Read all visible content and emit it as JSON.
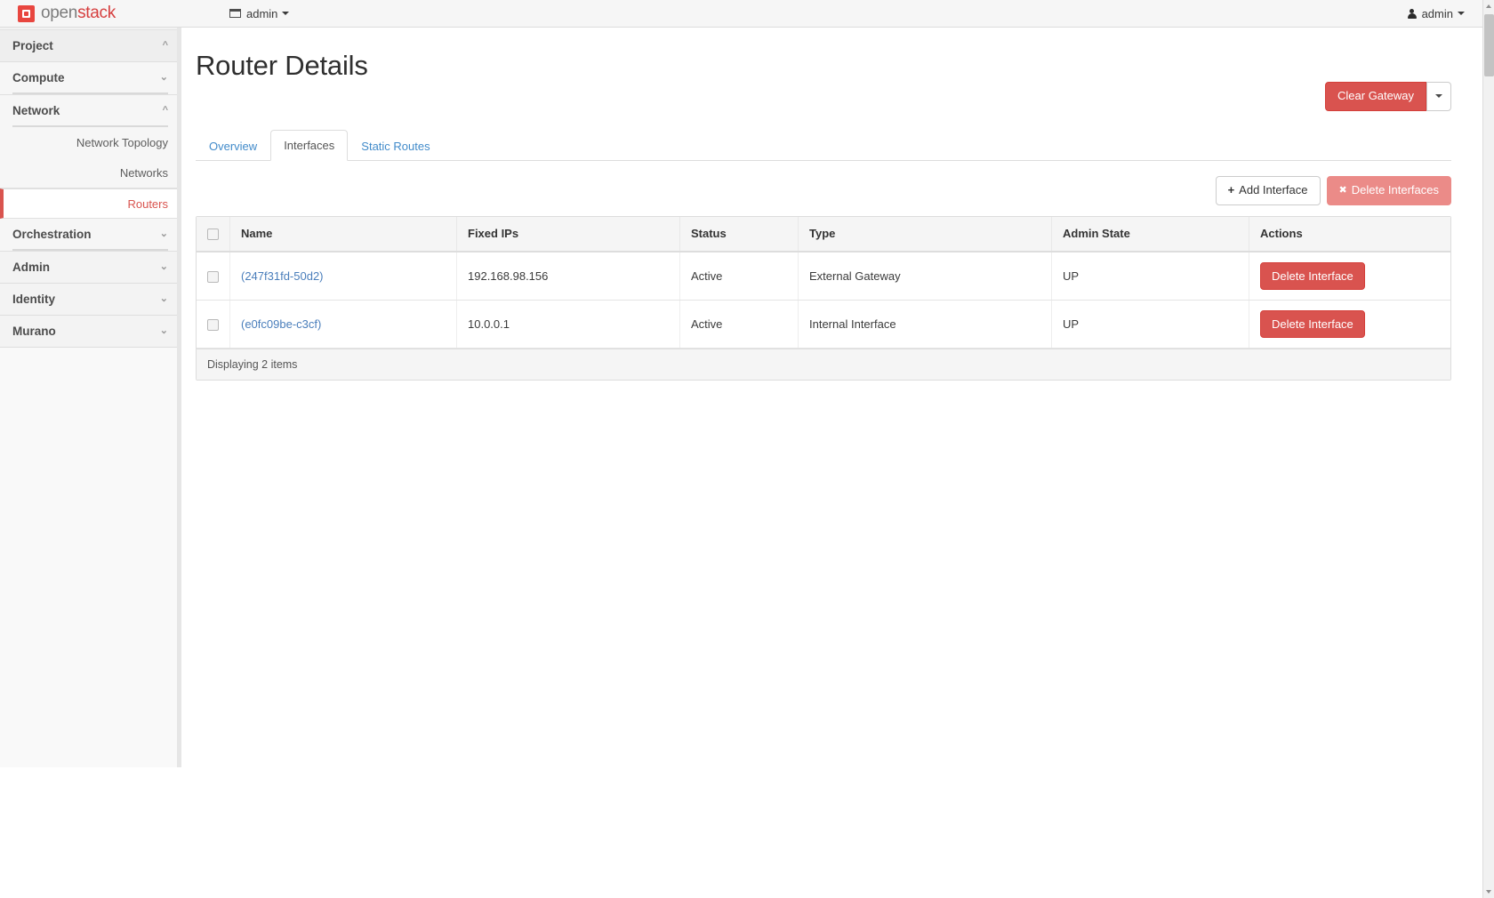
{
  "navbar": {
    "brand_open": "open",
    "brand_stack": "stack",
    "context_label": "admin",
    "context_icon": "window-icon",
    "user_label": "admin",
    "user_icon": "user-icon"
  },
  "sidebar": {
    "project_label": "Project",
    "sections": [
      {
        "label": "Compute",
        "expanded": false,
        "chevron": "chevron-down"
      },
      {
        "label": "Network",
        "expanded": true,
        "chevron": "chevron-up"
      }
    ],
    "network_links": [
      {
        "label": "Network Topology",
        "active": false
      },
      {
        "label": "Networks",
        "active": false
      },
      {
        "label": "Routers",
        "active": true
      }
    ],
    "groups": [
      {
        "label": "Orchestration",
        "chevron": "chevron-down"
      },
      {
        "label": "Admin",
        "chevron": "chevron-down"
      },
      {
        "label": "Identity",
        "chevron": "chevron-down"
      },
      {
        "label": "Murano",
        "chevron": "chevron-down"
      }
    ]
  },
  "page": {
    "title": "Router Details",
    "clear_gateway_label": "Clear Gateway",
    "gateway_dropdown_icon": "caret-down-icon"
  },
  "tabs": [
    {
      "label": "Overview",
      "active": false
    },
    {
      "label": "Interfaces",
      "active": true
    },
    {
      "label": "Static Routes",
      "active": false
    }
  ],
  "toolbar": {
    "add_interface_label": "Add Interface",
    "add_interface_icon": "plus-icon",
    "delete_interfaces_label": "Delete Interfaces",
    "delete_interfaces_icon": "x-icon",
    "delete_interfaces_disabled": true
  },
  "table": {
    "columns": [
      "Name",
      "Fixed IPs",
      "Status",
      "Type",
      "Admin State",
      "Actions"
    ],
    "rows": [
      {
        "name": "(247f31fd-50d2)",
        "fixed_ips": "192.168.98.156",
        "status": "Active",
        "type": "External Gateway",
        "admin_state": "UP",
        "action_label": "Delete Interface"
      },
      {
        "name": "(e0fc09be-c3cf)",
        "fixed_ips": "10.0.0.1",
        "status": "Active",
        "type": "Internal Interface",
        "admin_state": "UP",
        "action_label": "Delete Interface"
      }
    ],
    "footer": "Displaying 2 items"
  },
  "colors": {
    "brand_red": "#d63f3f",
    "danger": "#d9534f",
    "link_blue": "#428bca",
    "active_nav": "#d9544f"
  }
}
